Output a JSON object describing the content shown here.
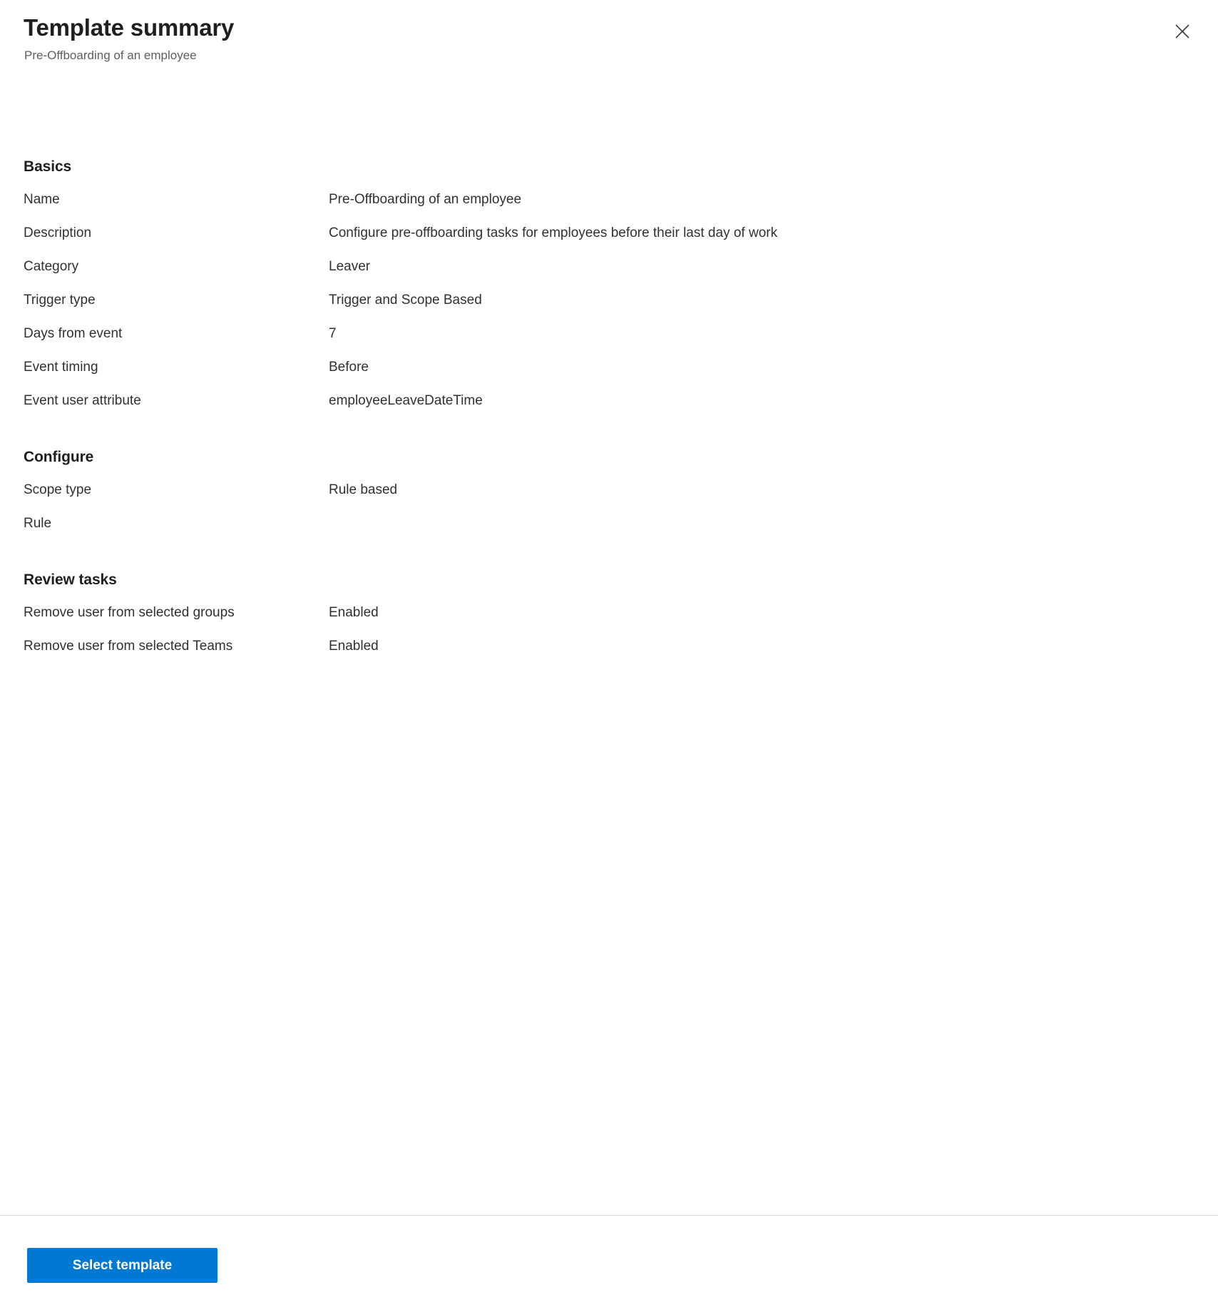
{
  "header": {
    "title": "Template summary",
    "subtitle": "Pre-Offboarding of an employee",
    "close_icon": "close-icon",
    "close_label": "Close"
  },
  "sections": [
    {
      "heading": "Basics",
      "rows": [
        {
          "label": "Name",
          "value": "Pre-Offboarding of an employee"
        },
        {
          "label": "Description",
          "value": "Configure pre-offboarding tasks for employees before their last day of work"
        },
        {
          "label": "Category",
          "value": "Leaver"
        },
        {
          "label": "Trigger type",
          "value": "Trigger and Scope Based"
        },
        {
          "label": "Days from event",
          "value": "7"
        },
        {
          "label": "Event timing",
          "value": "Before"
        },
        {
          "label": "Event user attribute",
          "value": "employeeLeaveDateTime"
        }
      ]
    },
    {
      "heading": "Configure",
      "rows": [
        {
          "label": "Scope type",
          "value": "Rule based"
        },
        {
          "label": "Rule",
          "value": ""
        }
      ]
    },
    {
      "heading": "Review tasks",
      "rows": [
        {
          "label": "Remove user from selected groups",
          "value": "Enabled"
        },
        {
          "label": "Remove user from selected Teams",
          "value": "Enabled"
        }
      ]
    }
  ],
  "footer": {
    "primary_button_label": "Select template"
  },
  "colors": {
    "accent": "#0078d4",
    "text_primary": "#323130",
    "text_heading": "#201f1e",
    "text_secondary": "#605e5c",
    "divider": "#d6d6d6",
    "background": "#ffffff"
  }
}
